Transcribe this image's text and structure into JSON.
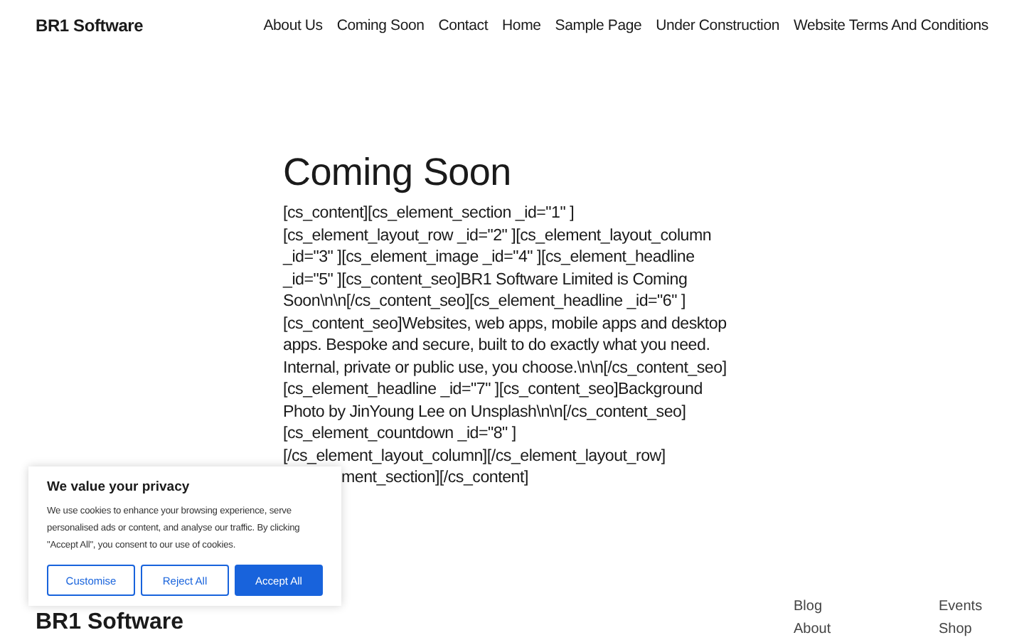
{
  "header": {
    "brand": "BR1 Software",
    "nav": [
      "About Us",
      "Coming Soon",
      "Contact",
      "Home",
      "Sample Page",
      "Under Construction",
      "Website Terms And Conditions"
    ]
  },
  "main": {
    "title": "Coming Soon",
    "lines": [
      {
        "text": "[cs_content][cs_element_section _id=\"1\" ]",
        "cut_left": false
      },
      {
        "text": "[cs_element_layout_row _id=\"2\" ][cs_element_layout_column",
        "cut_left": false
      },
      {
        "text": "_id=\"3\" ][cs_element_image _id=\"4\" ][cs_element_headline",
        "cut_left": false
      },
      {
        "text": "_id=\"5\" ][cs_content_seo]BR1 Software Limited is Coming",
        "cut_left": false
      },
      {
        "text": "Soon\\n\\n[/cs_content_seo][cs_element_headline _id=\"6\" ]",
        "cut_left": false
      },
      {
        "text": "[cs_content_seo]Websites, web apps, mobile apps and desktop",
        "cut_left": false
      },
      {
        "text": "apps. Bespoke and secure, built to do exactly what you need.",
        "cut_left": false
      },
      {
        "text": "Internal, private or public use, you choose.\\n\\n[/cs_content_seo]",
        "cut_left": false
      },
      {
        "text": "[cs_element_headline _id=\"7\" ][cs_content_seo]Background",
        "cut_left": false
      },
      {
        "text": "Photo by JinYoung Lee on Unsplash\\n\\n[/cs_content_seo]",
        "cut_left": false
      },
      {
        "text": "[cs_element_countdown _id=\"8\" ]",
        "cut_left": false
      },
      {
        "text": "[/cs_element_layout_column][/cs_element_layout_row]",
        "cut_left": false
      },
      {
        "text": "ment_section][/cs_content]",
        "cut_left": true
      }
    ]
  },
  "cookie_banner": {
    "title": "We value your privacy",
    "text": "We use cookies to enhance your browsing experience, serve personalised ads or content, and analyse our traffic. By clicking \"Accept All\", you consent to our use of cookies.",
    "buttons": [
      {
        "label": "Customise",
        "kind": "outline"
      },
      {
        "label": "Reject All",
        "kind": "outline"
      },
      {
        "label": "Accept All",
        "kind": "primary"
      }
    ]
  },
  "footer": {
    "brand": "BR1 Software",
    "links": [
      "Blog",
      "Events",
      "About",
      "Shop"
    ]
  }
}
